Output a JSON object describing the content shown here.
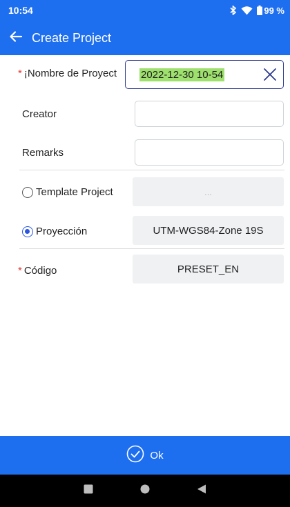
{
  "status_bar": {
    "time": "10:54",
    "battery": "99 %",
    "icons": [
      "bluetooth-icon",
      "wifi-icon",
      "battery-icon"
    ]
  },
  "app_bar": {
    "title": "Create Project",
    "back_icon": "arrow-left-icon"
  },
  "form": {
    "project_name": {
      "required_mark": "*",
      "label": "¡Nombre de Proyect",
      "value": "2022-12-30 10-54",
      "clear_icon": "close-icon"
    },
    "creator": {
      "label": "Creator",
      "value": ""
    },
    "remarks": {
      "label": "Remarks",
      "value": ""
    },
    "template_project": {
      "label": "Template Project",
      "checked": false,
      "value": "..."
    },
    "projection": {
      "label": "Proyección",
      "checked": true,
      "value": "UTM-WGS84-Zone 19S"
    },
    "code": {
      "required_mark": "*",
      "label": "Código",
      "value": "PRESET_EN"
    }
  },
  "footer": {
    "ok_label": "Ok",
    "ok_icon": "check-circle-icon"
  },
  "nav_bar": {
    "icons": [
      "recent-apps-icon",
      "home-icon",
      "back-icon"
    ]
  },
  "colors": {
    "primary": "#1e6ff0",
    "required": "#e53935",
    "highlight": "#9ee06e",
    "focus_border": "#2e3a8c",
    "radio": "#2a55e5"
  }
}
